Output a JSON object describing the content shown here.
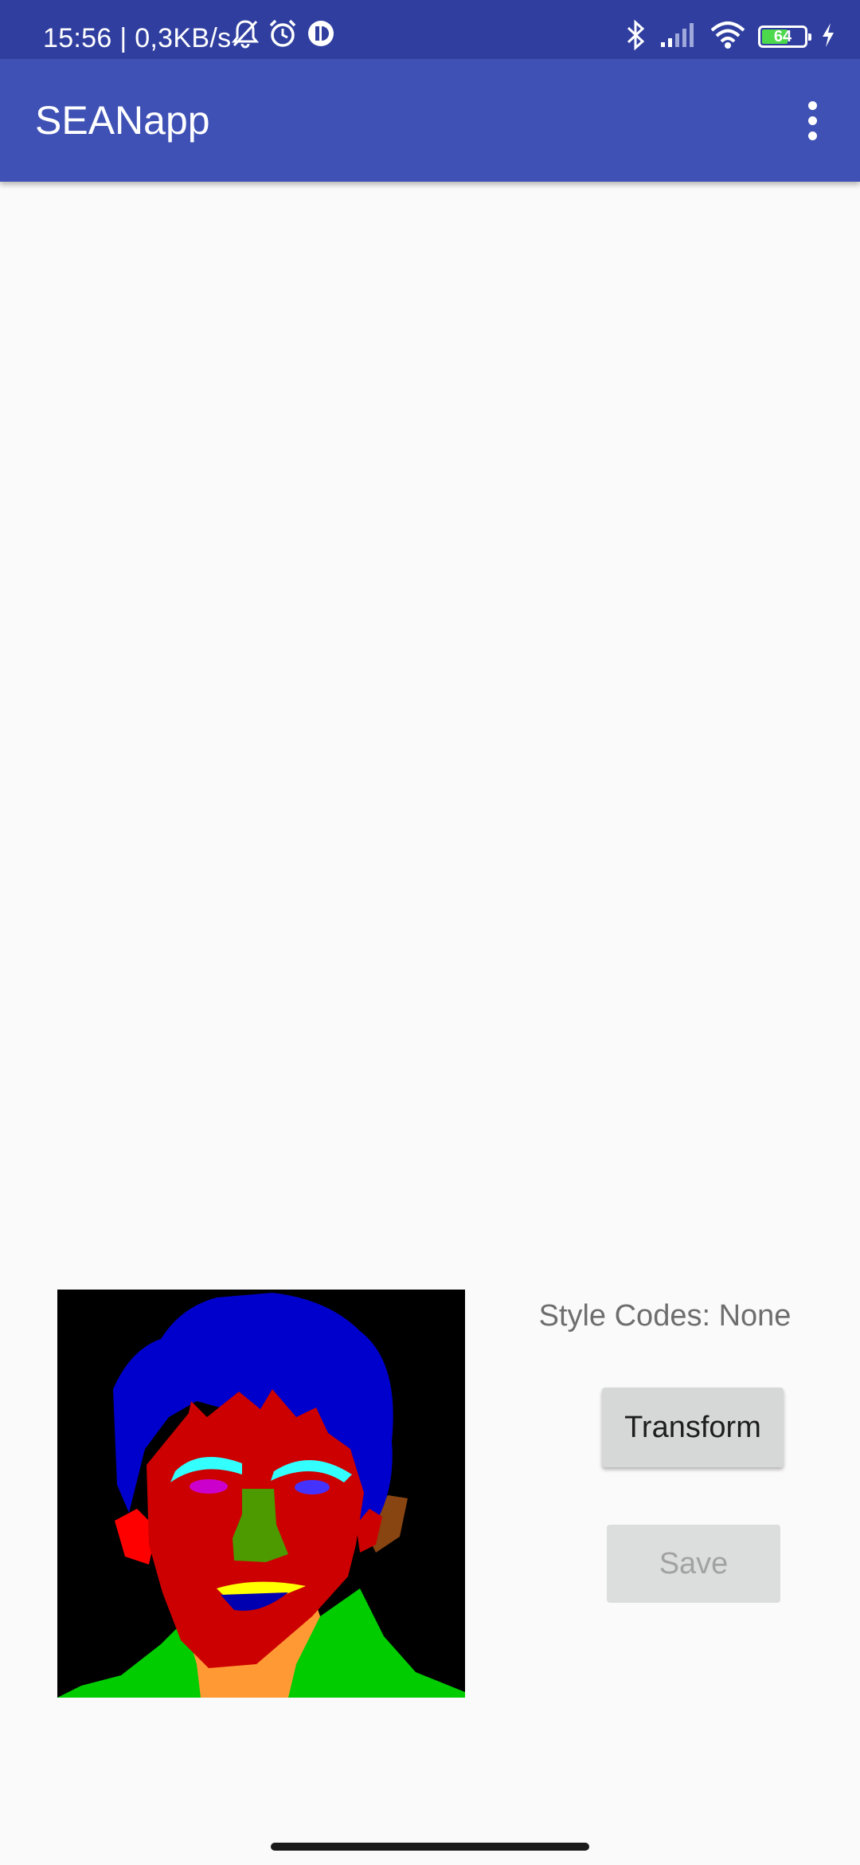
{
  "status_bar": {
    "time_speed": "15:56 | 0,3KB/s",
    "battery_level": "64",
    "battery_fill_fraction": 0.64,
    "icons_left": [
      "bell-off-icon",
      "alarm-icon",
      "pie-app-icon"
    ],
    "icons_right": [
      "bluetooth-icon",
      "signal-icon",
      "wifi-icon",
      "battery-icon",
      "charging-icon"
    ]
  },
  "app_bar": {
    "title": "SEANapp",
    "menu_icon": "overflow-menu-icon"
  },
  "main": {
    "style_codes_label": "Style Codes: None",
    "transform_label": "Transform",
    "save_label": "Save"
  },
  "colors": {
    "status_bar": "#303f9f",
    "app_bar": "#3f51b5",
    "background": "#fafafa",
    "button": "#d6d7d7",
    "hair": "#0000cc",
    "skin": "#cc0000",
    "brow": "#33ffff",
    "eye": "#cc00cc",
    "nose": "#4c9900",
    "lip_upper": "#ffff00",
    "mouth": "#0000b0",
    "neck": "#ff9933",
    "cloth": "#00cc00",
    "ear": "#ff0000"
  }
}
